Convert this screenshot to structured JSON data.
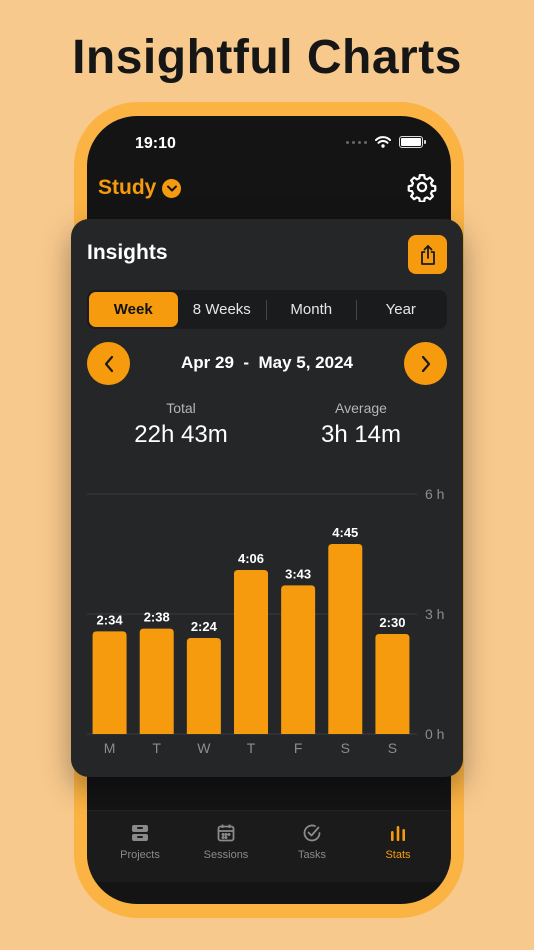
{
  "headline": "Insightful Charts",
  "status": {
    "time": "19:10"
  },
  "app": {
    "title": "Study"
  },
  "card": {
    "title": "Insights",
    "segments": [
      "Week",
      "8 Weeks",
      "Month",
      "Year"
    ],
    "active_segment": "Week",
    "date_range": "Apr 29  -  May 5, 2024",
    "total_label": "Total",
    "total_value": "22h 43m",
    "average_label": "Average",
    "average_value": "3h 14m"
  },
  "tabs": [
    {
      "label": "Projects",
      "icon": "tray-icon"
    },
    {
      "label": "Sessions",
      "icon": "calendar-icon"
    },
    {
      "label": "Tasks",
      "icon": "checkmark-circle-icon"
    },
    {
      "label": "Stats",
      "icon": "bar-chart-icon",
      "active": true
    }
  ],
  "colors": {
    "accent": "#f69b0e",
    "background": "#f8c98d",
    "card": "#252628"
  },
  "chart_data": {
    "type": "bar",
    "categories": [
      "M",
      "T",
      "W",
      "T",
      "F",
      "S",
      "S"
    ],
    "values": [
      2.567,
      2.633,
      2.4,
      4.1,
      3.717,
      4.75,
      2.5
    ],
    "data_labels": [
      "2:34",
      "2:38",
      "2:24",
      "4:06",
      "3:43",
      "4:45",
      "2:30"
    ],
    "y_ticks": [
      "0 h",
      "3 h",
      "6 h"
    ],
    "ylim": [
      0,
      6
    ],
    "grid": true
  }
}
